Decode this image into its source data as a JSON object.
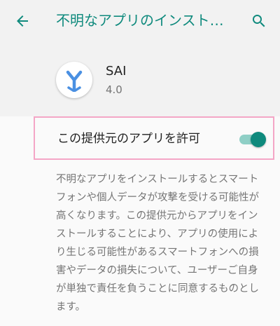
{
  "appbar": {
    "title": "不明なアプリのインストール",
    "back_icon": "arrow-back-icon",
    "search_icon": "search-icon"
  },
  "app": {
    "name": "SAI",
    "version": "4.0",
    "icon": "sai-app-icon"
  },
  "setting": {
    "label": "この提供元のアプリを許可",
    "enabled": true
  },
  "description": "不明なアプリをインストールするとスマートフォンや個人データが攻撃を受ける可能性が高くなります。この提供元からアプリをインストールすることにより、アプリの使用により生じる可能性があるスマートフォンへの損害やデータの損失について、ユーザーご自身が単独で責任を負うことに同意するものとします。",
  "colors": {
    "accent": "#0f8a7d",
    "switch_track": "#8fcfc6",
    "highlight_border": "#f4a6c6",
    "icon_blue": "#4a90e2"
  }
}
